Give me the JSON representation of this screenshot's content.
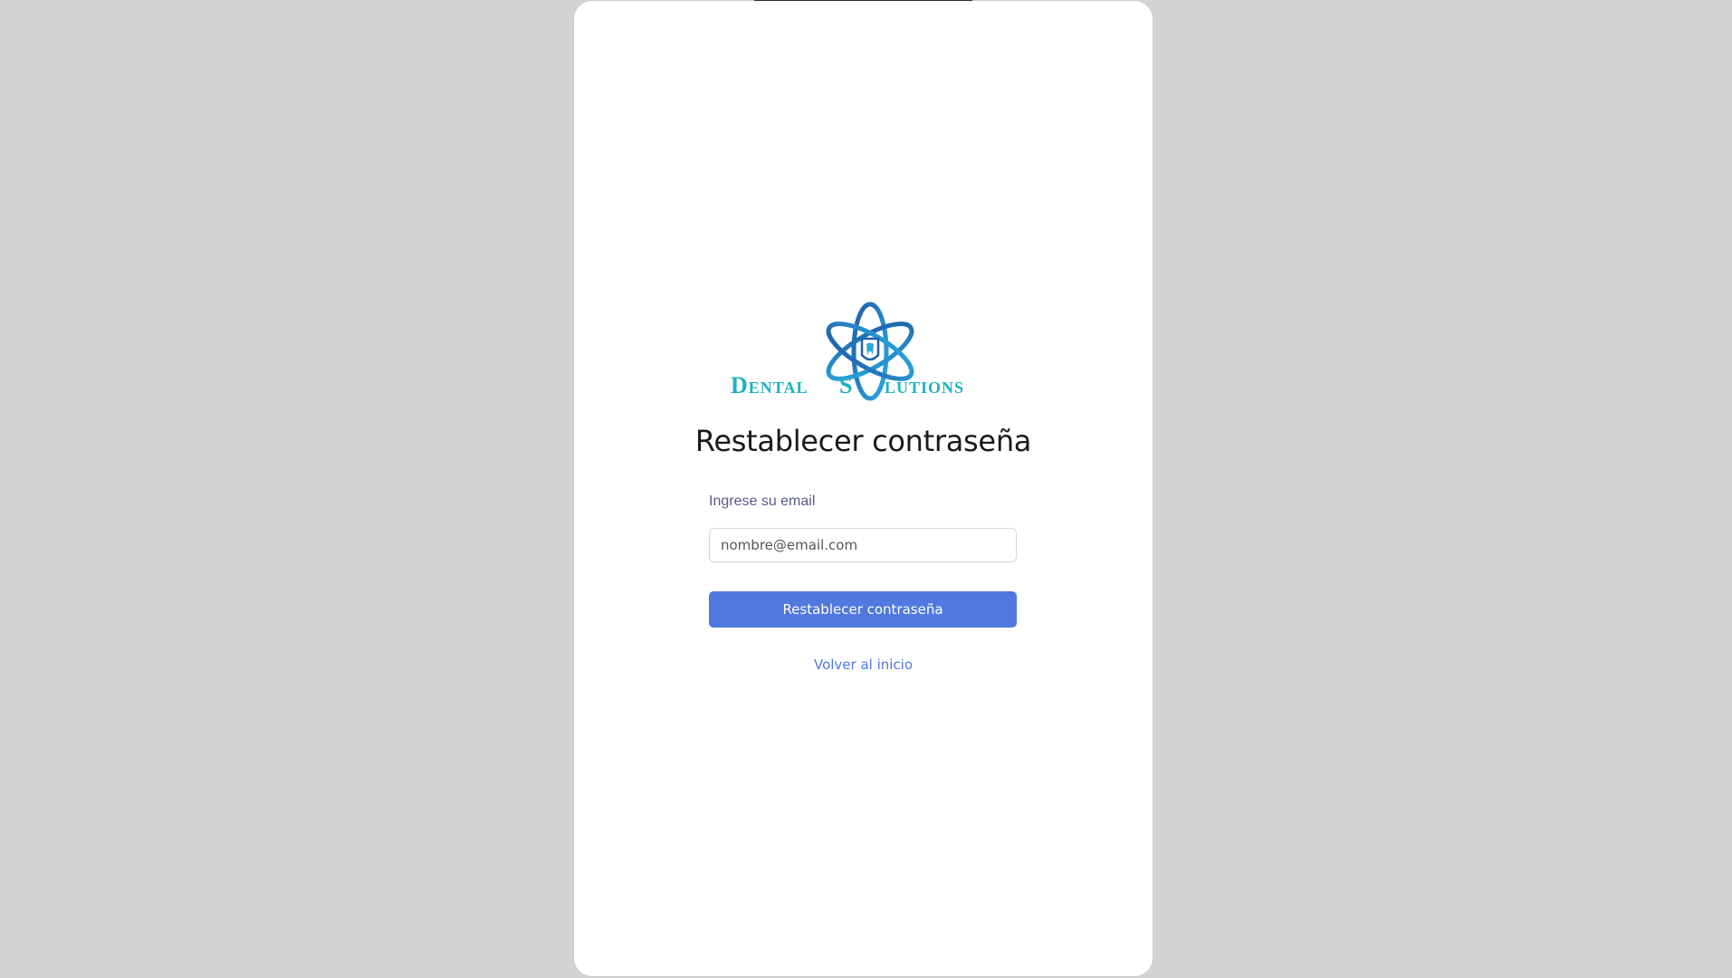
{
  "brand": {
    "logo_text_left": "Dental",
    "logo_text_s": "S",
    "logo_text_right": "lutions",
    "logo_colors": {
      "orbit_dark": "#1f5fa8",
      "orbit_light": "#2aa8e0",
      "text": "#1bb3c4"
    }
  },
  "page": {
    "title": "Restablecer contraseña"
  },
  "form": {
    "email_label": "Ingrese su email",
    "email_placeholder": "nombre@email.com",
    "email_value": "",
    "submit_label": "Restablecer contraseña"
  },
  "links": {
    "back_label": "Volver al inicio"
  },
  "colors": {
    "background": "#d3d3d3",
    "card": "#ffffff",
    "primary": "#5078df",
    "label": "#5a5a8a"
  }
}
